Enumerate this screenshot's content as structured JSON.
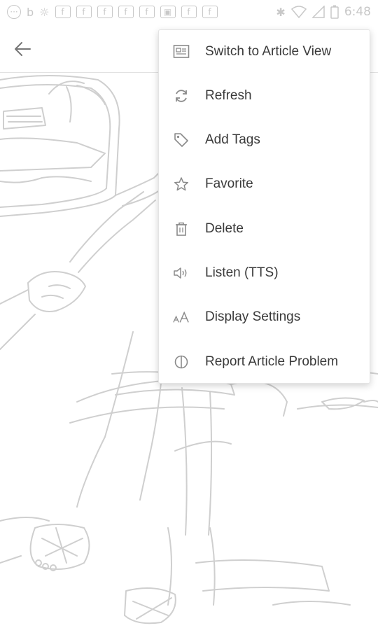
{
  "status_bar": {
    "time": "6:48",
    "left_icons": [
      "more-icon",
      "b-app-icon",
      "fox-app-icon",
      "f",
      "f",
      "f",
      "f",
      "f",
      "car-icon",
      "f",
      "f"
    ],
    "facebook_letter": "f",
    "b_letter": "b"
  },
  "toolbar": {
    "back_icon": "arrow-left-icon"
  },
  "menu": {
    "items": [
      {
        "label": "Switch to Article View",
        "icon": "article-view-icon"
      },
      {
        "label": "Refresh",
        "icon": "refresh-icon"
      },
      {
        "label": "Add Tags",
        "icon": "tag-icon"
      },
      {
        "label": "Favorite",
        "icon": "star-icon"
      },
      {
        "label": "Delete",
        "icon": "trash-icon"
      },
      {
        "label": "Listen (TTS)",
        "icon": "speaker-icon"
      },
      {
        "label": "Display Settings",
        "icon": "font-size-icon"
      },
      {
        "label": "Report Article Problem",
        "icon": "report-icon"
      }
    ]
  }
}
